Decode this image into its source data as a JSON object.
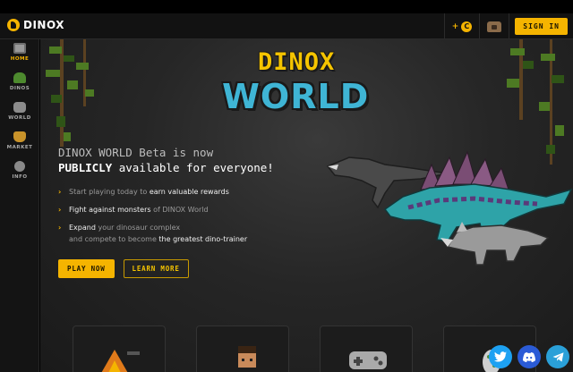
{
  "header": {
    "logo_text": "DINOX",
    "coin_plus": "+",
    "coin_symbol": "C",
    "signin_label": "SIGN IN"
  },
  "sidebar": {
    "items": [
      {
        "label": "HOME",
        "icon": "home-icon",
        "active": true
      },
      {
        "label": "DINOS",
        "icon": "dino-icon"
      },
      {
        "label": "WORLD",
        "icon": "gamepad-icon"
      },
      {
        "label": "MARKET",
        "icon": "market-icon"
      },
      {
        "label": "INFO",
        "icon": "info-icon"
      }
    ]
  },
  "hero": {
    "logo_top": "DINOX",
    "logo_bottom": "WORLD",
    "headline_line1": "DINOX WORLD Beta is now",
    "headline_line2_bold": "PUBLICLY",
    "headline_line2_rest": " available for everyone!",
    "bullets": [
      {
        "pre": "Start playing today to ",
        "hl": "earn valuable rewards",
        "post": ""
      },
      {
        "pre": "",
        "hl": "Fight against monsters",
        "post": " of DINOX World"
      },
      {
        "pre": "",
        "hl": "Expand",
        "post": " your dinosaur complex"
      }
    ],
    "bullet3_line2_pre": "and compete to become ",
    "bullet3_line2_hl": "the greatest dino-trainer",
    "play_now_label": "PLAY NOW",
    "learn_more_label": "LEARN MORE"
  },
  "colors": {
    "accent": "#f5b400",
    "world_blue": "#3fb5d5",
    "twitter": "#1da1f2",
    "discord": "#2b5bd6",
    "telegram": "#2aa0d8"
  },
  "social": [
    {
      "name": "twitter-icon"
    },
    {
      "name": "discord-icon"
    },
    {
      "name": "telegram-icon"
    }
  ]
}
